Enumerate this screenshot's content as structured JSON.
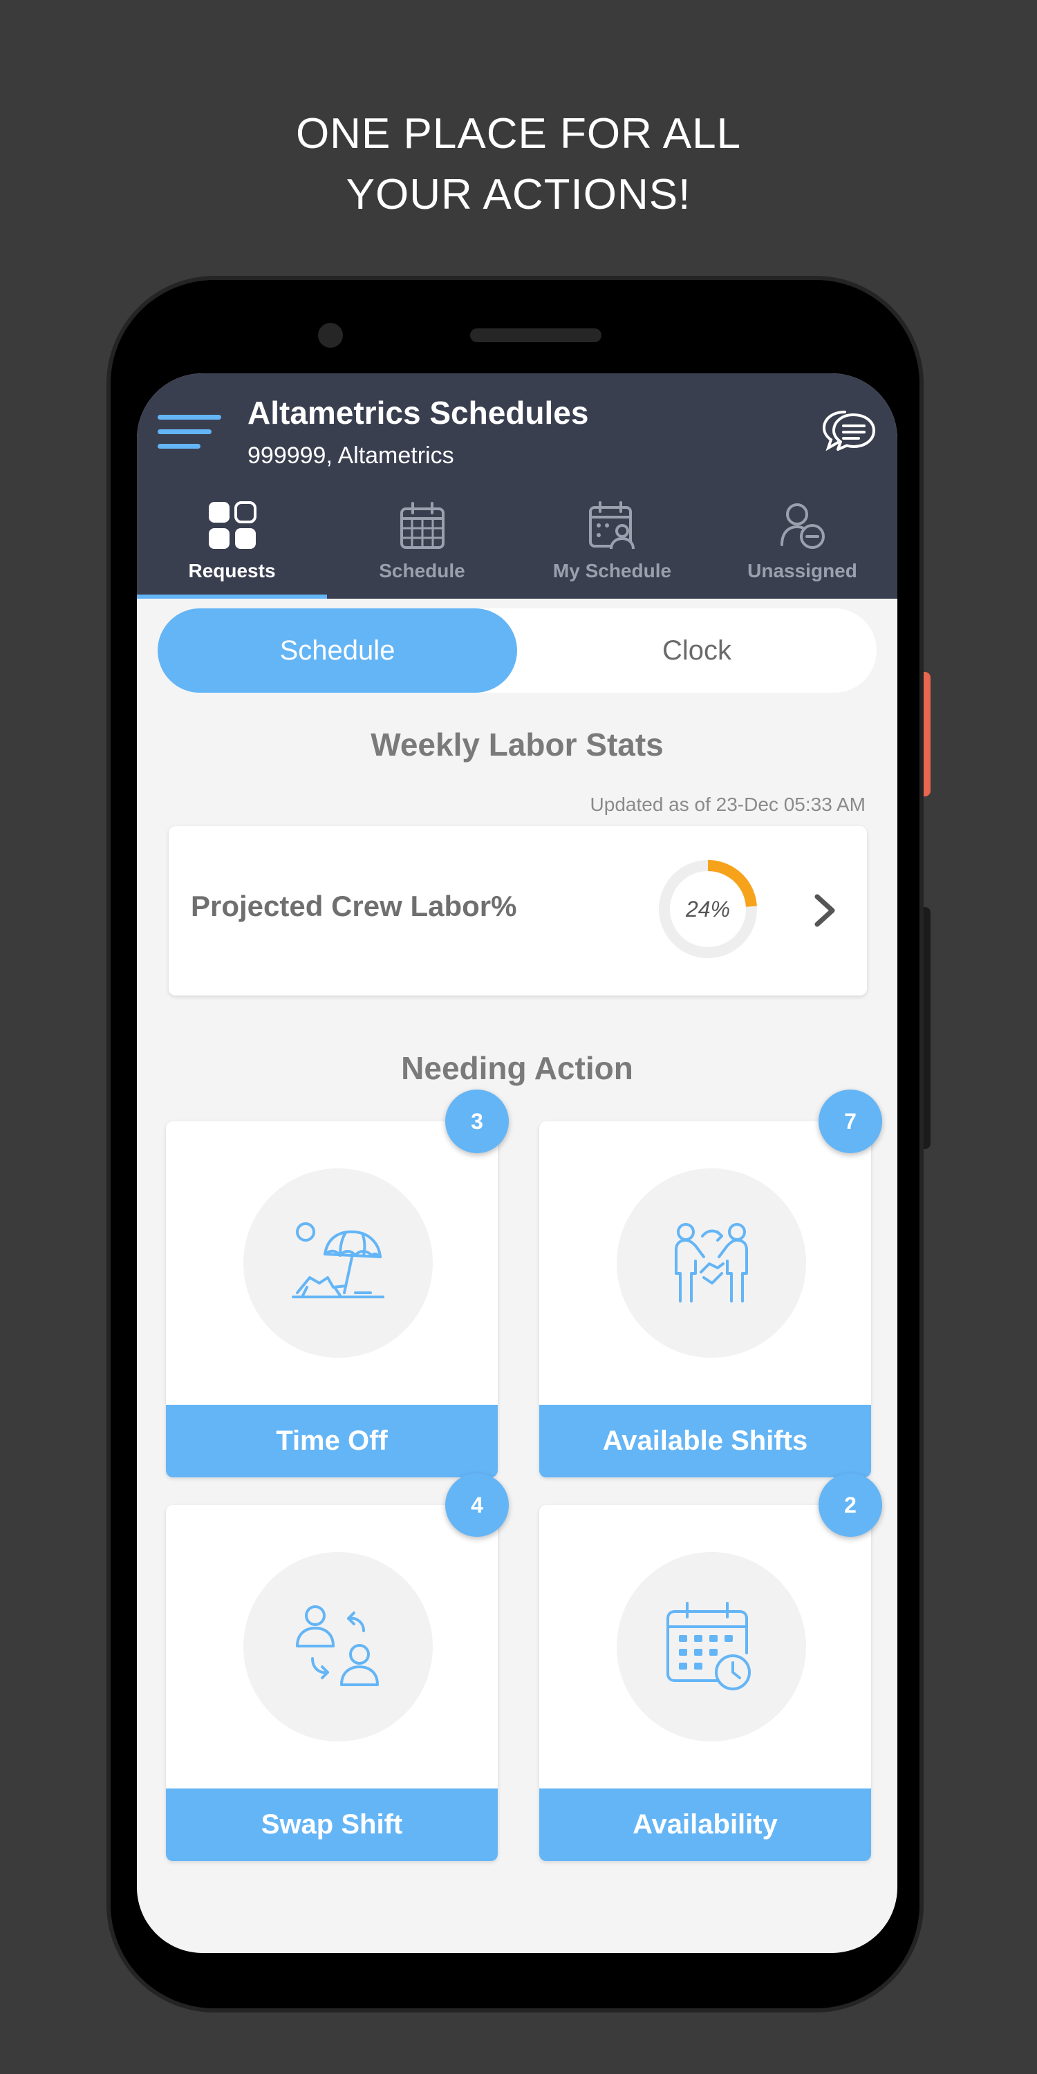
{
  "promo": {
    "line1": "ONE PLACE FOR ALL",
    "line2": "YOUR ACTIONS!"
  },
  "header": {
    "title": "Altametrics Schedules",
    "subtitle": "999999, Altametrics",
    "menu_icon": "hamburger-menu-icon",
    "chat_icon": "chat-bubbles-icon"
  },
  "tabs": [
    {
      "label": "Requests",
      "icon": "grid-icon",
      "active": true
    },
    {
      "label": "Schedule",
      "icon": "calendar-icon",
      "active": false
    },
    {
      "label": "My Schedule",
      "icon": "user-calendar-icon",
      "active": false
    },
    {
      "label": "Unassigned",
      "icon": "user-minus-icon",
      "active": false
    }
  ],
  "toggle": {
    "active": "Schedule",
    "inactive": "Clock"
  },
  "weekly_stats": {
    "title": "Weekly Labor Stats",
    "updated": "Updated as of 23-Dec 05:33 AM",
    "card_label": "Projected Crew Labor%",
    "percent_text": "24%",
    "percent_value": 24,
    "ring_color": "#f7a21b",
    "track_color": "#eeeeee"
  },
  "needing_action": {
    "title": "Needing Action",
    "cards": [
      {
        "label": "Time Off",
        "count": "3",
        "icon": "beach-umbrella-icon"
      },
      {
        "label": "Available Shifts",
        "count": "7",
        "icon": "handshake-swap-icon"
      },
      {
        "label": "Swap Shift",
        "count": "4",
        "icon": "user-swap-icon"
      },
      {
        "label": "Availability",
        "count": "2",
        "icon": "calendar-clock-icon"
      }
    ]
  },
  "colors": {
    "accent": "#64b5f6",
    "appbar": "#3a3f50",
    "background": "#f4f4f4",
    "page": "#3b3b3b"
  }
}
